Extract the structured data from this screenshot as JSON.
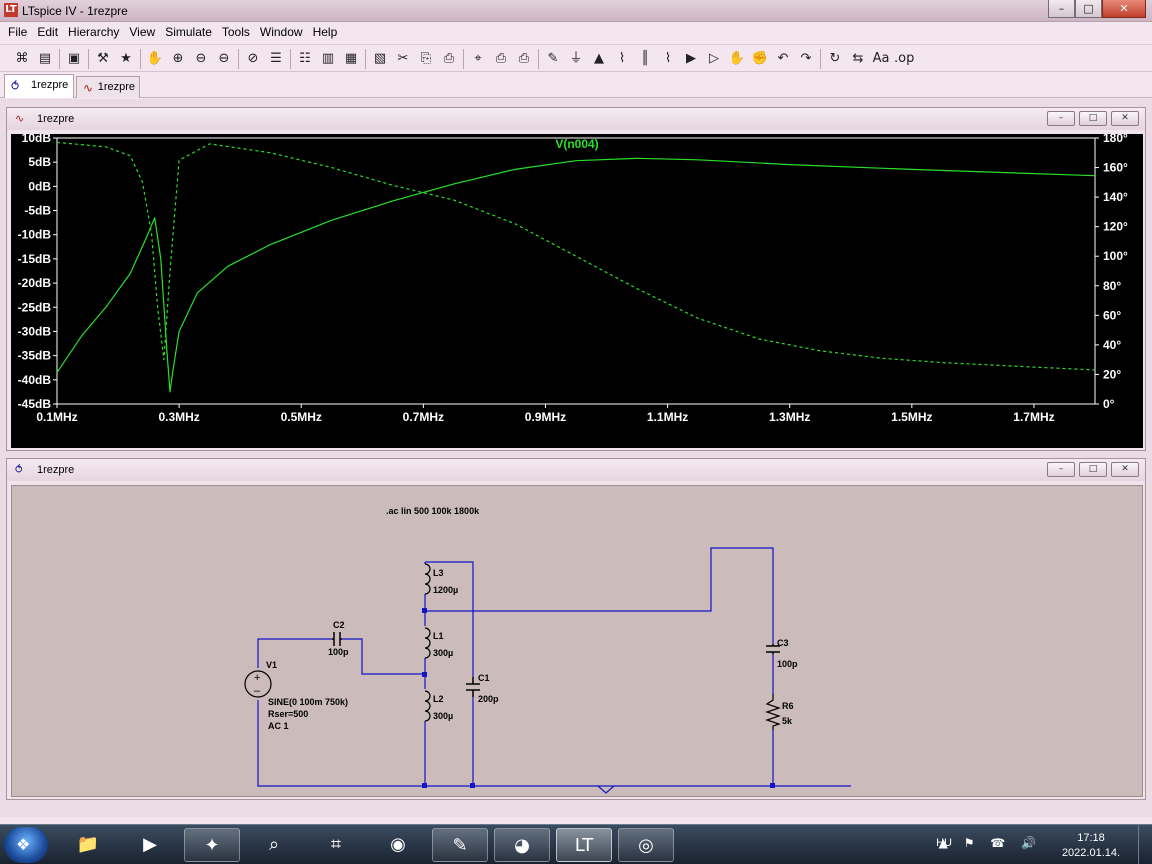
{
  "app": {
    "title": "LTspice IV - 1rezpre",
    "logo_glyph": "LT",
    "window_buttons": [
      "–",
      "□",
      "✕"
    ]
  },
  "menu": [
    "File",
    "Edit",
    "Hierarchy",
    "View",
    "Simulate",
    "Tools",
    "Window",
    "Help"
  ],
  "toolbar": {
    "icons": [
      "new-schematic",
      "open",
      "save",
      "control-panel",
      "run",
      "halt",
      "zoom-to-rectangle",
      "zoom-back",
      "zoom-out",
      "zoom-extents",
      "autorange",
      "grid",
      "tile-horizontally",
      "cascade",
      "close-all",
      "cut",
      "copy",
      "paste",
      "find",
      "print-setup",
      "print",
      "draw-wire",
      "ground",
      "label-net",
      "resistor",
      "capacitor",
      "inductor",
      "diode",
      "component",
      "move",
      "drag",
      "undo",
      "redo",
      "rotate",
      "mirror",
      "text",
      "spice-directive"
    ],
    "glyphs": [
      "⌘",
      "▤",
      "▣",
      "⚒",
      "★",
      "✋",
      "⊕",
      "⊖",
      "⊖",
      "⊘",
      "☰",
      "☷",
      "▥",
      "▦",
      "▧",
      "✂",
      "⎘",
      "⎙",
      "⌖",
      "⎙",
      "⎙",
      "✎",
      "⏚",
      "▲",
      "⌇",
      "║",
      "⌇",
      "▶",
      "▷",
      "✋",
      "✊",
      "↶",
      "↷",
      "↻",
      "⇆",
      "Aa",
      ".op"
    ]
  },
  "tabs": [
    {
      "label": "1rezpre",
      "type": "schematic",
      "active": true
    },
    {
      "label": "1rezpre",
      "type": "waveform",
      "active": false
    }
  ],
  "plot_window": {
    "title": "1rezpre",
    "buttons": [
      "–",
      "□",
      "✕"
    ]
  },
  "schematic_window": {
    "title": "1rezpre",
    "buttons": [
      "–",
      "□",
      "✕"
    ]
  },
  "colors": {
    "plot_bg": "#000000",
    "trace": "#28e028",
    "axis_text": "#ffffff",
    "wire": "#1414c8",
    "schematic_bg": "#cbbbbb"
  },
  "chart_data": {
    "type": "line",
    "title": "V(n004)",
    "xlabel": "",
    "ylabel": "",
    "x_scale": "linear",
    "x_ticks": [
      "0.1MHz",
      "0.3MHz",
      "0.5MHz",
      "0.7MHz",
      "0.9MHz",
      "1.1MHz",
      "1.3MHz",
      "1.5MHz",
      "1.7MHz"
    ],
    "xlim_mhz": [
      0.1,
      1.8
    ],
    "y_left_ticks": [
      "10dB",
      "5dB",
      "0dB",
      "-5dB",
      "-10dB",
      "-15dB",
      "-20dB",
      "-25dB",
      "-30dB",
      "-35dB",
      "-40dB",
      "-45dB"
    ],
    "y_left_lim_db": [
      -45,
      10
    ],
    "y_right_ticks": [
      "180°",
      "160°",
      "140°",
      "120°",
      "100°",
      "80°",
      "60°",
      "40°",
      "20°",
      "0°"
    ],
    "y_right_lim_deg": [
      0,
      180
    ],
    "grid": false,
    "series": [
      {
        "name": "V(n004)",
        "style": "solid",
        "axis": "left",
        "x_mhz": [
          0.1,
          0.14,
          0.18,
          0.22,
          0.245,
          0.26,
          0.27,
          0.28,
          0.285,
          0.29,
          0.3,
          0.33,
          0.38,
          0.45,
          0.55,
          0.65,
          0.75,
          0.85,
          0.95,
          1.05,
          1.15,
          1.3,
          1.5,
          1.8
        ],
        "y_db": [
          -38.5,
          -31,
          -25,
          -18,
          -11,
          -6.5,
          -15,
          -34,
          -42.5,
          -38,
          -30,
          -22,
          -16.5,
          -12,
          -7,
          -3,
          0.5,
          3.5,
          5.3,
          5.8,
          5.5,
          4.5,
          3.5,
          2.2
        ]
      },
      {
        "name": "phase",
        "style": "dashed",
        "axis": "right",
        "x_mhz": [
          0.1,
          0.18,
          0.22,
          0.24,
          0.255,
          0.265,
          0.275,
          0.285,
          0.3,
          0.35,
          0.45,
          0.55,
          0.65,
          0.75,
          0.85,
          0.95,
          1.05,
          1.15,
          1.25,
          1.35,
          1.45,
          1.55,
          1.65,
          1.8
        ],
        "y_deg": [
          177,
          174,
          168,
          150,
          115,
          65,
          30,
          90,
          165,
          176,
          170,
          160,
          148,
          138,
          122,
          100,
          78,
          58,
          44,
          36,
          31,
          28,
          26,
          23
        ]
      }
    ]
  },
  "schematic": {
    "directive": ".ac lin 500 100k 1800k",
    "components": [
      {
        "ref": "V1",
        "value_lines": [
          "SINE(0 100m 750k)",
          "Rser=500",
          "AC 1"
        ]
      },
      {
        "ref": "C2",
        "value": "100p"
      },
      {
        "ref": "L3",
        "value": "1200µ"
      },
      {
        "ref": "L1",
        "value": "300µ"
      },
      {
        "ref": "L2",
        "value": "300µ"
      },
      {
        "ref": "C1",
        "value": "200p"
      },
      {
        "ref": "C3",
        "value": "100p"
      },
      {
        "ref": "R6",
        "value": "5k"
      }
    ]
  },
  "taskbar": {
    "apps": [
      {
        "name": "explorer",
        "glyph": "📁",
        "state": "pinned"
      },
      {
        "name": "media-player",
        "glyph": "▶",
        "state": "pinned"
      },
      {
        "name": "satellite",
        "glyph": "✦",
        "state": "open"
      },
      {
        "name": "search-app",
        "glyph": "⌕",
        "state": "pinned"
      },
      {
        "name": "calculator",
        "glyph": "⌗",
        "state": "pinned"
      },
      {
        "name": "chrome",
        "glyph": "◉",
        "state": "pinned"
      },
      {
        "name": "notes",
        "glyph": "✎",
        "state": "open"
      },
      {
        "name": "firefox",
        "glyph": "◕",
        "state": "open"
      },
      {
        "name": "ltspice",
        "glyph": "LT",
        "state": "active"
      },
      {
        "name": "eye-app",
        "glyph": "◎",
        "state": "open"
      }
    ],
    "language": "HU",
    "tray_glyphs": "▲ ⚑ ☎ 🔊",
    "time": "17:18",
    "date": "2022.01.14."
  }
}
